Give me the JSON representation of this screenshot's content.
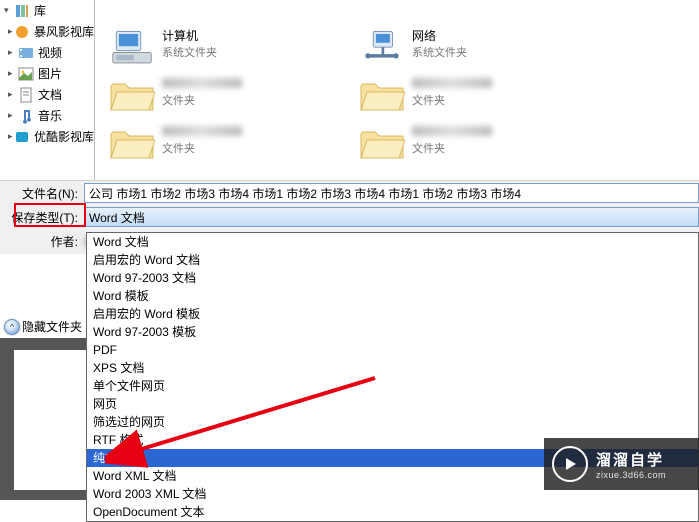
{
  "sidebar": {
    "items": [
      {
        "label": "库",
        "icon": "library"
      },
      {
        "label": "暴风影视库",
        "icon": "storm"
      },
      {
        "label": "视频",
        "icon": "video"
      },
      {
        "label": "图片",
        "icon": "picture"
      },
      {
        "label": "文档",
        "icon": "document"
      },
      {
        "label": "音乐",
        "icon": "music"
      },
      {
        "label": "优酷影视库",
        "icon": "youku"
      }
    ]
  },
  "files": {
    "items": [
      {
        "name": "计算机",
        "sub": "系统文件夹",
        "icon": "computer"
      },
      {
        "name": "网络",
        "sub": "系统文件夹",
        "icon": "network"
      },
      {
        "name": "",
        "sub": "文件夹",
        "icon": "folder",
        "redacted": true
      },
      {
        "name": "",
        "sub": "文件夹",
        "icon": "folder",
        "redacted": true
      },
      {
        "name": "",
        "sub": "文件夹",
        "icon": "folder",
        "redacted": true
      },
      {
        "name": "",
        "sub": "文件夹",
        "icon": "folder",
        "redacted": true
      }
    ]
  },
  "form": {
    "filename_label": "文件名(N):",
    "filename_value": "公司 市场1 市场2 市场3 市场4 市场1 市场2 市场3 市场4 市场1 市场2 市场3 市场4",
    "savetype_label": "保存类型(T):",
    "savetype_value": "Word 文档",
    "author_label": "作者:"
  },
  "dropdown": {
    "items": [
      "Word 文档",
      "启用宏的 Word 文档",
      "Word 97-2003 文档",
      "Word 模板",
      "启用宏的 Word 模板",
      "Word 97-2003 模板",
      "PDF",
      "XPS 文档",
      "单个文件网页",
      "网页",
      "筛选过的网页",
      "RTF 格式",
      "纯文本",
      "Word XML 文档",
      "Word 2003 XML 文档",
      "OpenDocument 文本"
    ],
    "selected_index": 12
  },
  "hide_folders_label": "隐藏文件夹",
  "watermark": {
    "title": "溜溜自学",
    "url": "zixue.3d66.com"
  }
}
